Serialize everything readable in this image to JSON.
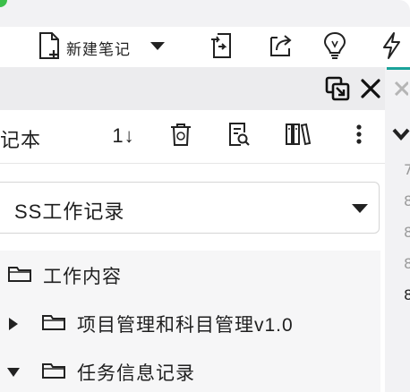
{
  "toolbar": {
    "new_note_label": "新建笔记",
    "icons": [
      "new-note-icon",
      "dropdown-caret-icon",
      "import-icon",
      "share-icon",
      "idea-icon",
      "flash-icon"
    ]
  },
  "panel": {
    "icons": [
      "detach-window-icon",
      "close-icon"
    ]
  },
  "notebook_toolbar": {
    "title": "记本",
    "sort_label": "1↓",
    "icons": [
      "trash-icon",
      "search-note-icon",
      "library-icon",
      "more-icon"
    ]
  },
  "notebook_selector": {
    "value": "SS工作记录"
  },
  "tree": {
    "items": [
      {
        "label": "工作内容",
        "expand": "none"
      },
      {
        "label": "项目管理和科目管理v1.0",
        "expand": "collapsed"
      },
      {
        "label": "任务信息记录",
        "expand": "expanded"
      }
    ]
  },
  "right_rail": {
    "line_numbers": [
      "7",
      "8",
      "8",
      "8",
      "8"
    ]
  },
  "colors": {
    "accent": "#1aa39a",
    "green": "#3cbf4a",
    "panel_bg": "#ececee",
    "tree_bg": "#f6f6f7"
  }
}
